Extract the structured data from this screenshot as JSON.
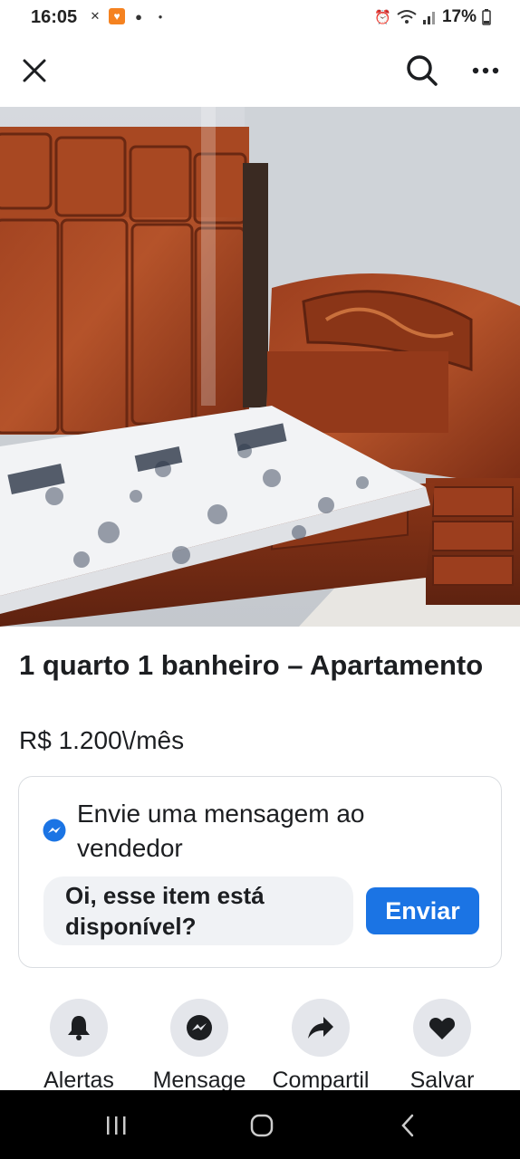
{
  "status_bar": {
    "time": "16:05",
    "battery": "17%",
    "left_icons": [
      "gmail-icon",
      "app-badge-icon",
      "chat-icon",
      "notification-dot-icon"
    ],
    "right_icons": [
      "alarm-icon",
      "wifi-icon",
      "signal-icon",
      "battery-icon"
    ]
  },
  "app_bar": {
    "close_icon": "close-icon",
    "search_icon": "search-icon",
    "more_icon": "more-icon"
  },
  "photo": {
    "total_images": 6,
    "active_index": 0
  },
  "listing": {
    "title": "1 quarto 1 banheiro – Apartamento",
    "price": "R$ 1.200\\/mês"
  },
  "message_card": {
    "title": "Envie uma mensagem ao vendedor",
    "input_value": "Oi, esse item está disponível?",
    "send_label": "Enviar",
    "accent": "#1b74e4"
  },
  "actions": [
    {
      "label": "Alertas",
      "icon": "bell-icon"
    },
    {
      "label": "Mensage",
      "icon": "messenger-icon"
    },
    {
      "label": "Compartil",
      "icon": "share-icon"
    },
    {
      "label": "Salvar",
      "icon": "heart-icon"
    }
  ],
  "nav_bar": {
    "icons": [
      "recents-icon",
      "home-icon",
      "back-icon"
    ]
  }
}
